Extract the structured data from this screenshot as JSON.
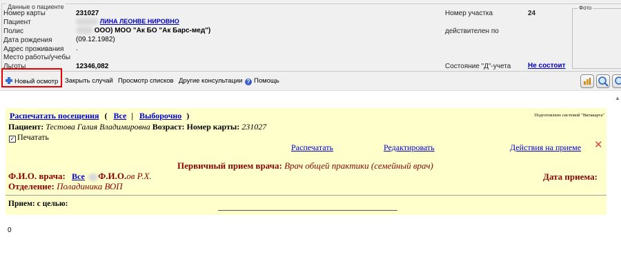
{
  "patient_panel": {
    "legend": "Данные о пациенте",
    "labels": {
      "card_number": "Номер карты",
      "patient": "Пациент",
      "policy": "Полис",
      "birth_date": "Дата рождения",
      "address": "Адрес проживания",
      "work_place": "Место работы/учебы",
      "benefits": "Льготы",
      "district_number": "Номер участка",
      "valid_until": "действителен по",
      "d_status": "Состояние \"Д\"-учета"
    },
    "values": {
      "card_number": "231027",
      "patient_partial": "ЛИНА ЛЕОНВЕ НИРОВНО",
      "policy_partial": "ООО) МОО \"Ак БО \"Ак Барс-мед\")",
      "birth_date_partial": "(09.12.1982)",
      "address": ".",
      "benefits": "12346,082",
      "district_number": "24",
      "d_status_link": "Не состоит"
    },
    "photo_legend": "Фото"
  },
  "toolbar": {
    "new_exam": "Новый осмотр",
    "close_case": "Закрыть случай",
    "view_lists": "Просмотр списков",
    "other_consultations": "Другие консультации",
    "help": "Помощь"
  },
  "record": {
    "print_visits": "Распечатать посещения",
    "paren_open": "(",
    "all": "Все",
    "separator": "|",
    "selective": "Выборочно",
    "paren_close": ")",
    "prepared_by": "Подготовлено системой \"Витакарта\"",
    "patient_label": "Пациент:",
    "patient_name": "Тестова Галия Владимировна",
    "age_label": "Возраст:",
    "card_label": "Номер карты:",
    "card_value": "231027",
    "print_checkbox": "Печатать",
    "print_link": "Распечатать",
    "edit_link": "Редактировать",
    "actions_link": "Действия на приеме",
    "close_glyph": "✕",
    "primary_label": "Первичный прием врача:",
    "primary_value": "Врач общей практики (семейный врач)",
    "doctor_label": "Ф.И.О. врача:",
    "doctor_all": "Все",
    "doctor_prefix": "Ф.И.О.",
    "doctor_value": "ов Р.Х.",
    "date_label": "Дата приема:",
    "dept_label": "Отделение:",
    "dept_value": "Поладиника ВОП",
    "purpose_label": "Прием: с целью:"
  },
  "footer": {
    "zero": "0"
  }
}
